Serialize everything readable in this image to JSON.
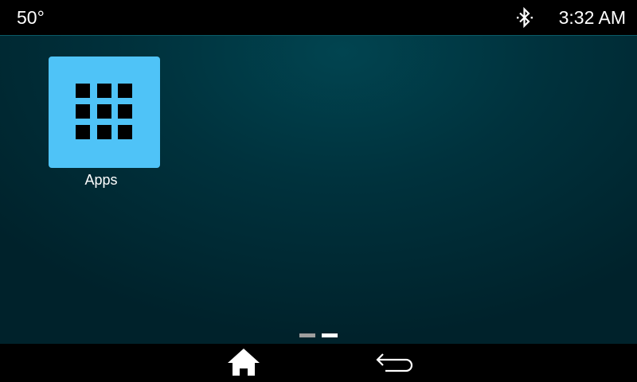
{
  "status_bar": {
    "temperature": "50°",
    "bluetooth_icon": "bluetooth-icon",
    "time": "3:32 AM"
  },
  "home": {
    "apps": [
      {
        "label": "Apps",
        "icon": "apps-grid-icon",
        "tile_color": "#4fc3f7"
      }
    ],
    "pages": {
      "count": 2,
      "current": 2
    }
  },
  "nav_bar": {
    "home_icon": "home-icon",
    "back_icon": "back-arrow-icon"
  },
  "colors": {
    "background": "#00323d",
    "accent": "#4fc3f7",
    "bar": "#000000",
    "text": "#ffffff"
  }
}
